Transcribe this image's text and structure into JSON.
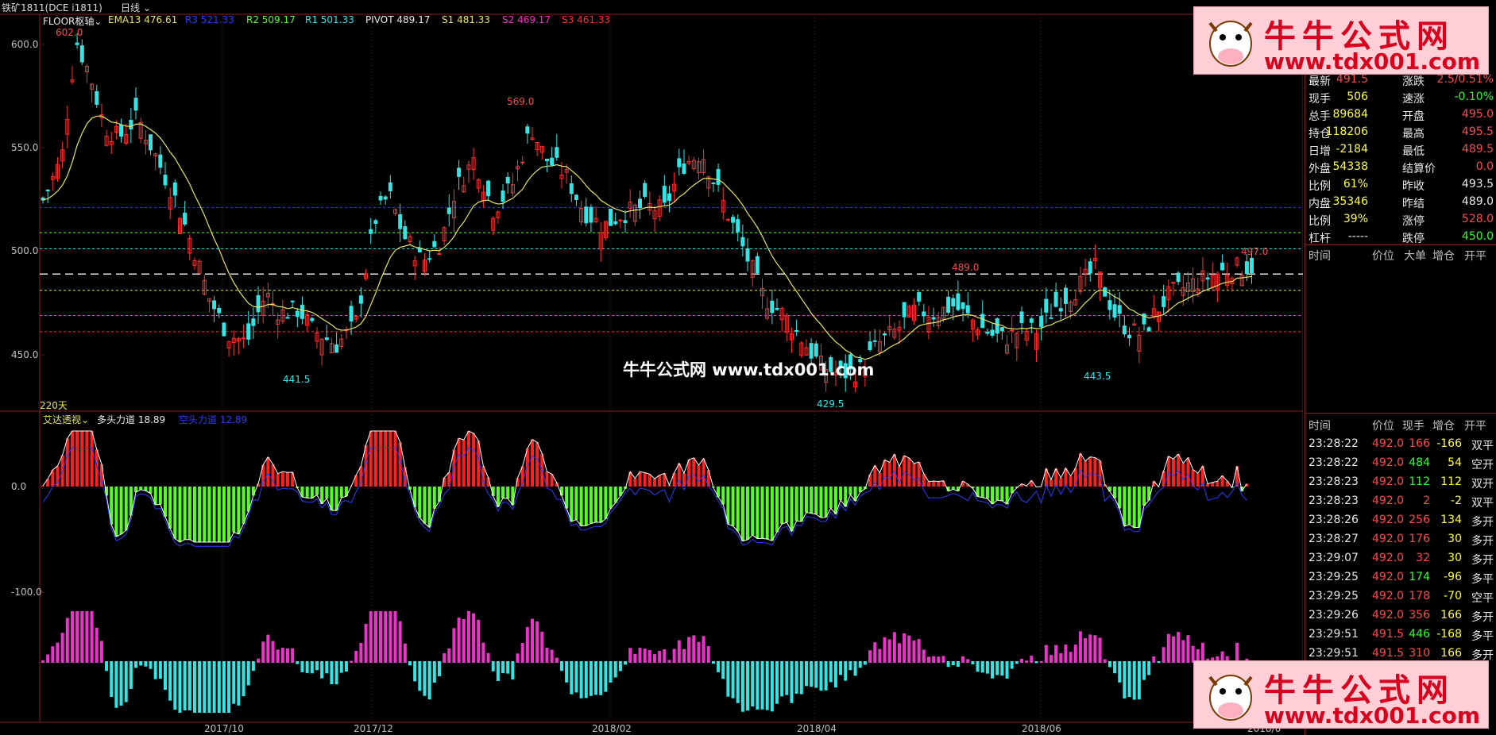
{
  "header": {
    "symbol": "铁矿1811(DCE i1811)",
    "period": "日线",
    "indicator": "FLOOR枢轴",
    "ema": "EMA13 476.61",
    "r3": "R3 521.33",
    "r2": "R2 509.17",
    "r1": "R1 501.33",
    "pivot": "PIVOT 489.17",
    "s1": "S1 481.33",
    "s2": "S2 469.17",
    "s3": "S3 461.33"
  },
  "main_chart": {
    "y_ticks": [
      "600.0",
      "550.0",
      "500.0",
      "450.0"
    ],
    "peak_labels": [
      "602.0",
      "569.0",
      "489.0",
      "497.0"
    ],
    "trough_labels": [
      "441.5",
      "429.5",
      "443.5"
    ],
    "days_label": "220天"
  },
  "sub_chart": {
    "indicator": "艾达透视",
    "bull_label": "多头力道 18.89",
    "bear_label": "空头力道 12.89",
    "y_ticks": [
      "0.0",
      "-100.0"
    ]
  },
  "x_axis": [
    "2017/10",
    "2017/12",
    "2018/02",
    "2018/04",
    "2018/06",
    "2018/0"
  ],
  "center_watermark": "牛牛公式网 www.tdx001.com",
  "watermark": {
    "cn": "牛牛公式网",
    "url": "www.tdx001.com"
  },
  "quote_panel": [
    {
      "l1": "最新",
      "v1": "491.5",
      "c1": "red",
      "l2": "涨跌",
      "v2": "2.5/0.51%",
      "c2": "red"
    },
    {
      "l1": "现手",
      "v1": "506",
      "c1": "yel",
      "l2": "速涨",
      "v2": "-0.10%",
      "c2": "grn"
    },
    {
      "l1": "总手",
      "v1": "89684",
      "c1": "yel",
      "l2": "开盘",
      "v2": "495.0",
      "c2": "red"
    },
    {
      "l1": "持仓",
      "v1": "118206",
      "c1": "yel",
      "l2": "最高",
      "v2": "495.5",
      "c2": "red"
    },
    {
      "l1": "日增",
      "v1": "-2184",
      "c1": "yel",
      "l2": "最低",
      "v2": "489.5",
      "c2": "red"
    },
    {
      "l1": "外盘",
      "v1": "54338",
      "c1": "yel",
      "l2": "结算价",
      "v2": "0.0",
      "c2": "red"
    },
    {
      "l1": "比例",
      "v1": "61%",
      "c1": "yel",
      "l2": "昨收",
      "v2": "493.5",
      "c2": "wht"
    },
    {
      "l1": "内盘",
      "v1": "35346",
      "c1": "yel",
      "l2": "昨结",
      "v2": "489.0",
      "c2": "wht"
    },
    {
      "l1": "比例",
      "v1": "39%",
      "c1": "yel",
      "l2": "涨停",
      "v2": "528.0",
      "c2": "red"
    },
    {
      "l1": "杠杆",
      "v1": "-----",
      "c1": "wht",
      "l2": "跌停",
      "v2": "450.0",
      "c2": "grn"
    }
  ],
  "ticks_header_top": [
    "时间",
    "价位",
    "大单",
    "增仓",
    "开平"
  ],
  "ticks_header": [
    "时间",
    "价位",
    "现手",
    "增仓",
    "开平"
  ],
  "ticks": [
    {
      "time": "23:28:22",
      "price": "492.0",
      "vol": "166",
      "vc": "red",
      "oi": "-166",
      "type": "双平"
    },
    {
      "time": "23:28:22",
      "price": "492.0",
      "vol": "484",
      "vc": "grn",
      "oi": "54",
      "type": "空开"
    },
    {
      "time": "23:28:23",
      "price": "492.0",
      "vol": "112",
      "vc": "grn",
      "oi": "112",
      "type": "双开"
    },
    {
      "time": "23:28:23",
      "price": "492.0",
      "vol": "2",
      "vc": "red",
      "oi": "-2",
      "type": "双平"
    },
    {
      "time": "23:28:26",
      "price": "492.0",
      "vol": "256",
      "vc": "red",
      "oi": "134",
      "type": "多开"
    },
    {
      "time": "23:28:27",
      "price": "492.0",
      "vol": "176",
      "vc": "red",
      "oi": "30",
      "type": "多开"
    },
    {
      "time": "23:29:07",
      "price": "492.0",
      "vol": "32",
      "vc": "red",
      "oi": "30",
      "type": "多开"
    },
    {
      "time": "23:29:25",
      "price": "492.0",
      "vol": "174",
      "vc": "grn",
      "oi": "-96",
      "type": "多平"
    },
    {
      "time": "23:29:25",
      "price": "492.0",
      "vol": "178",
      "vc": "red",
      "oi": "-70",
      "type": "空平"
    },
    {
      "time": "23:29:26",
      "price": "492.0",
      "vol": "356",
      "vc": "red",
      "oi": "166",
      "type": "多开"
    },
    {
      "time": "23:29:51",
      "price": "491.5",
      "vol": "446",
      "vc": "grn",
      "oi": "-168",
      "type": "多平"
    },
    {
      "time": "23:29:51",
      "price": "491.5",
      "vol": "310",
      "vc": "red",
      "oi": "166",
      "type": "多开"
    }
  ],
  "colors": {
    "up": "#ff3030",
    "down": "#33e6e6",
    "ema": "#e6e65c",
    "bull": "#ff2020",
    "bear": "#55ff22",
    "mag": "#ee33cc"
  }
}
